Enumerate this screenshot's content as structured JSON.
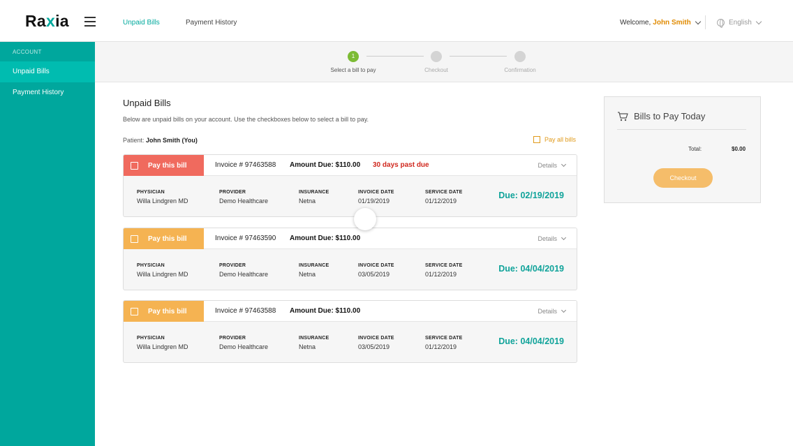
{
  "header": {
    "logo": {
      "prefix": "Ra",
      "accent": "x",
      "suffix": "ia"
    },
    "nav": {
      "unpaid": "Unpaid Bills",
      "history": "Payment History"
    },
    "welcome_label": "Welcome,",
    "user_name": "John Smith",
    "language": "English"
  },
  "sidebar": {
    "section": "ACCOUNT",
    "items": [
      {
        "label": "Unpaid Bills"
      },
      {
        "label": "Payment History"
      }
    ]
  },
  "stepper": {
    "active_step_number": "1",
    "steps": [
      {
        "label": "Select a bill to pay"
      },
      {
        "label": "Checkout"
      },
      {
        "label": "Confirmation"
      }
    ]
  },
  "main": {
    "title": "Unpaid Bills",
    "description": "Below are unpaid bills on your account. Use the checkboxes below to select a bill to pay.",
    "patient_label": "Patient:",
    "patient_name": "John Smith (You)",
    "pay_all": "Pay all bills"
  },
  "column_labels": {
    "physician": "PHYSICIAN",
    "provider": "PROVIDER",
    "insurance": "INSURANCE",
    "invoice_date": "INVOICE DATE",
    "service_date": "SERVICE DATE"
  },
  "bills": [
    {
      "pay_label": "Pay this bill",
      "invoice": "Invoice # 97463588",
      "amount": "Amount Due: $110.00",
      "overdue": "30 days past due",
      "details": "Details",
      "physician": "Willa Lindgren MD",
      "provider": "Demo Healthcare",
      "insurance": "Netna",
      "invoice_date": "01/19/2019",
      "service_date": "01/12/2019",
      "due": "Due: 02/19/2019"
    },
    {
      "pay_label": "Pay this bill",
      "invoice": "Invoice # 97463590",
      "amount": "Amount Due: $110.00",
      "overdue": "",
      "details": "Details",
      "physician": "Willa Lindgren MD",
      "provider": "Demo Healthcare",
      "insurance": "Netna",
      "invoice_date": "03/05/2019",
      "service_date": "01/12/2019",
      "due": "Due: 04/04/2019"
    },
    {
      "pay_label": "Pay this bill",
      "invoice": "Invoice # 97463588",
      "amount": "Amount Due: $110.00",
      "overdue": "",
      "details": "Details",
      "physician": "Willa Lindgren MD",
      "provider": "Demo Healthcare",
      "insurance": "Netna",
      "invoice_date": "03/05/2019",
      "service_date": "01/12/2019",
      "due": "Due: 04/04/2019"
    }
  ],
  "summary": {
    "title": "Bills to Pay Today",
    "total_label": "Total:",
    "total_value": "$0.00",
    "checkout": "Checkout"
  },
  "colors": {
    "brand": "#00a79d",
    "overdue_bill": "#f06a5e",
    "pending_bill": "#f5b352",
    "due_text": "#10a39a",
    "alert_text": "#d0281e",
    "step_active": "#7cbb34"
  }
}
